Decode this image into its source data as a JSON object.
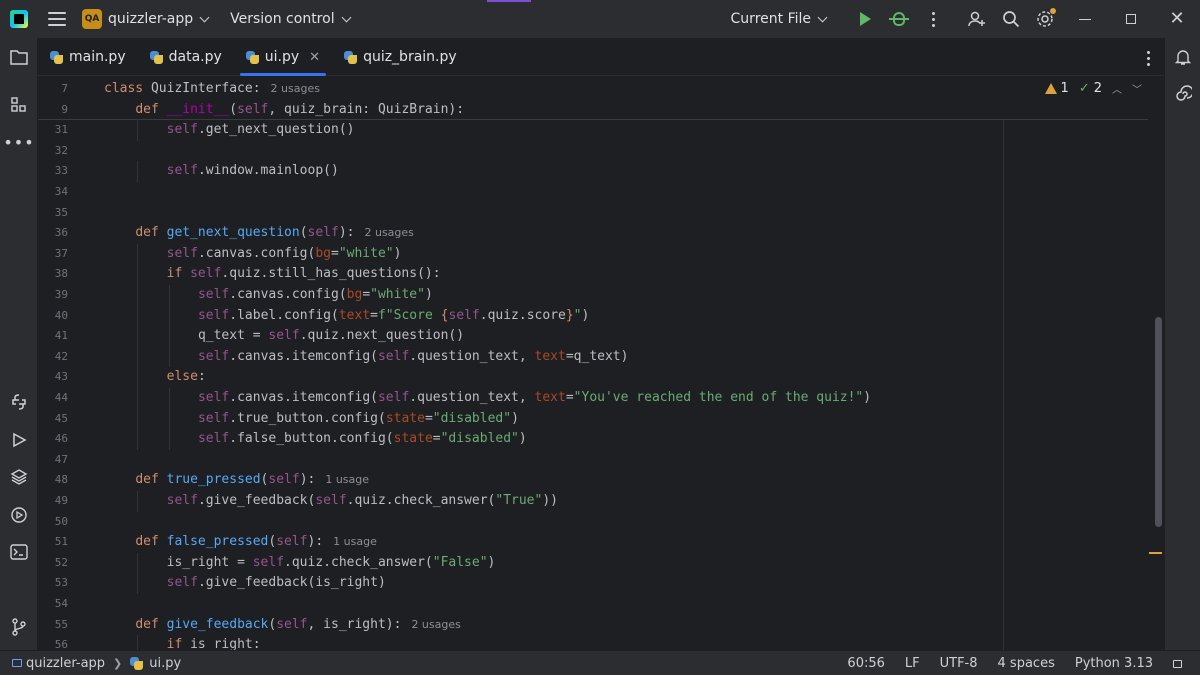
{
  "titlebar": {
    "project_badge": "QA",
    "project_name": "quizzler-app",
    "vcs_label": "Version control",
    "run_config": "Current File"
  },
  "tabs": [
    {
      "label": "main.py",
      "active": false
    },
    {
      "label": "data.py",
      "active": false
    },
    {
      "label": "ui.py",
      "active": true
    },
    {
      "label": "quiz_brain.py",
      "active": false
    }
  ],
  "inspection": {
    "warnings": "1",
    "ok": "2"
  },
  "editor": {
    "lines": [
      {
        "n": "7",
        "indent": 0,
        "tokens": [
          [
            "kw",
            "class "
          ],
          [
            "",
            "QuizInterface:"
          ]
        ],
        "hint": "2 usages"
      },
      {
        "n": "9",
        "indent": 1,
        "tokens": [
          [
            "kw",
            "def "
          ],
          [
            "dunder",
            "__init__"
          ],
          [
            "",
            "("
          ],
          [
            "self",
            "self"
          ],
          [
            "",
            ", quiz_brain: QuizBrain):"
          ]
        ]
      },
      {
        "n": "31",
        "indent": 2,
        "tokens": [
          [
            "self",
            "self"
          ],
          [
            "",
            ".get_next_question()"
          ]
        ]
      },
      {
        "n": "32",
        "indent": 0,
        "tokens": []
      },
      {
        "n": "33",
        "indent": 2,
        "tokens": [
          [
            "self",
            "self"
          ],
          [
            "",
            ".window.mainloop()"
          ]
        ]
      },
      {
        "n": "34",
        "indent": 0,
        "tokens": []
      },
      {
        "n": "35",
        "indent": 0,
        "tokens": []
      },
      {
        "n": "36",
        "indent": 1,
        "tokens": [
          [
            "kw",
            "def "
          ],
          [
            "fn",
            "get_next_question"
          ],
          [
            "",
            "("
          ],
          [
            "self",
            "self"
          ],
          [
            "",
            "):"
          ]
        ],
        "hint": "2 usages"
      },
      {
        "n": "37",
        "indent": 2,
        "tokens": [
          [
            "self",
            "self"
          ],
          [
            "",
            ".canvas.config("
          ],
          [
            "param",
            "bg"
          ],
          [
            "",
            "="
          ],
          [
            "str",
            "\"white\""
          ],
          [
            "",
            ")"
          ]
        ]
      },
      {
        "n": "38",
        "indent": 2,
        "tokens": [
          [
            "kw",
            "if "
          ],
          [
            "self",
            "self"
          ],
          [
            "",
            ".quiz.still_has_questions():"
          ]
        ]
      },
      {
        "n": "39",
        "indent": 3,
        "tokens": [
          [
            "self",
            "self"
          ],
          [
            "",
            ".canvas.config("
          ],
          [
            "param",
            "bg"
          ],
          [
            "",
            "="
          ],
          [
            "str",
            "\"white\""
          ],
          [
            "",
            ")"
          ]
        ]
      },
      {
        "n": "40",
        "indent": 3,
        "tokens": [
          [
            "self",
            "self"
          ],
          [
            "",
            ".label.config("
          ],
          [
            "param",
            "text"
          ],
          [
            "",
            "="
          ],
          [
            "str",
            "f\"Score "
          ],
          [
            "kw",
            "{"
          ],
          [
            "self",
            "self"
          ],
          [
            "",
            ".quiz.score"
          ],
          [
            "kw",
            "}"
          ],
          [
            "str",
            "\""
          ],
          [
            "",
            ")"
          ]
        ]
      },
      {
        "n": "41",
        "indent": 3,
        "tokens": [
          [
            "",
            "q_text = "
          ],
          [
            "self",
            "self"
          ],
          [
            "",
            ".quiz.next_question()"
          ]
        ]
      },
      {
        "n": "42",
        "indent": 3,
        "tokens": [
          [
            "self",
            "self"
          ],
          [
            "",
            ".canvas.itemconfig("
          ],
          [
            "self",
            "self"
          ],
          [
            "",
            ".question_text, "
          ],
          [
            "param",
            "text"
          ],
          [
            "",
            "=q_text)"
          ]
        ]
      },
      {
        "n": "43",
        "indent": 2,
        "tokens": [
          [
            "kw",
            "else"
          ],
          [
            "",
            ":"
          ]
        ]
      },
      {
        "n": "44",
        "indent": 3,
        "tokens": [
          [
            "self",
            "self"
          ],
          [
            "",
            ".canvas.itemconfig("
          ],
          [
            "self",
            "self"
          ],
          [
            "",
            ".question_text, "
          ],
          [
            "param",
            "text"
          ],
          [
            "",
            "="
          ],
          [
            "str",
            "\"You've reached the end of the quiz!\""
          ],
          [
            "",
            ")"
          ]
        ]
      },
      {
        "n": "45",
        "indent": 3,
        "tokens": [
          [
            "self",
            "self"
          ],
          [
            "",
            ".true_button.config("
          ],
          [
            "param",
            "state"
          ],
          [
            "",
            "="
          ],
          [
            "str",
            "\"disabled\""
          ],
          [
            "",
            ")"
          ]
        ]
      },
      {
        "n": "46",
        "indent": 3,
        "tokens": [
          [
            "self",
            "self"
          ],
          [
            "",
            ".false_button.config("
          ],
          [
            "param",
            "state"
          ],
          [
            "",
            "="
          ],
          [
            "str",
            "\"disabled\""
          ],
          [
            "",
            ")"
          ]
        ]
      },
      {
        "n": "47",
        "indent": 0,
        "tokens": []
      },
      {
        "n": "48",
        "indent": 1,
        "tokens": [
          [
            "kw",
            "def "
          ],
          [
            "fn",
            "true_pressed"
          ],
          [
            "",
            "("
          ],
          [
            "self",
            "self"
          ],
          [
            "",
            "):"
          ]
        ],
        "hint": "1 usage"
      },
      {
        "n": "49",
        "indent": 2,
        "tokens": [
          [
            "self",
            "self"
          ],
          [
            "",
            ".give_feedback("
          ],
          [
            "self",
            "self"
          ],
          [
            "",
            ".quiz.check_answer("
          ],
          [
            "str",
            "\"True\""
          ],
          [
            "",
            "))"
          ]
        ]
      },
      {
        "n": "50",
        "indent": 0,
        "tokens": []
      },
      {
        "n": "51",
        "indent": 1,
        "tokens": [
          [
            "kw",
            "def "
          ],
          [
            "fn",
            "false_pressed"
          ],
          [
            "",
            "("
          ],
          [
            "self",
            "self"
          ],
          [
            "",
            "):"
          ]
        ],
        "hint": "1 usage"
      },
      {
        "n": "52",
        "indent": 2,
        "tokens": [
          [
            "",
            "is_right = "
          ],
          [
            "self",
            "self"
          ],
          [
            "",
            ".quiz.check_answer("
          ],
          [
            "str",
            "\"False\""
          ],
          [
            "",
            ")"
          ]
        ]
      },
      {
        "n": "53",
        "indent": 2,
        "tokens": [
          [
            "self",
            "self"
          ],
          [
            "",
            ".give_feedback(is_right)"
          ]
        ]
      },
      {
        "n": "54",
        "indent": 0,
        "tokens": []
      },
      {
        "n": "55",
        "indent": 1,
        "tokens": [
          [
            "kw",
            "def "
          ],
          [
            "fn",
            "give_feedback"
          ],
          [
            "",
            "("
          ],
          [
            "self",
            "self"
          ],
          [
            "",
            ", is_right):"
          ]
        ],
        "hint": "2 usages"
      },
      {
        "n": "56",
        "indent": 2,
        "tokens": [
          [
            "kw",
            "if "
          ],
          [
            "",
            "is_right:"
          ]
        ]
      }
    ]
  },
  "statusbar": {
    "project": "quizzler-app",
    "file": "ui.py",
    "position": "60:56",
    "line_sep": "LF",
    "encoding": "UTF-8",
    "indent": "4 spaces",
    "interpreter": "Python 3.13"
  }
}
